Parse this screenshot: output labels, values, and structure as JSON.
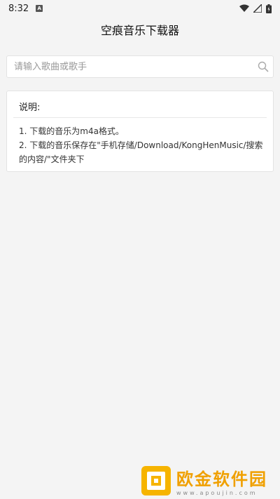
{
  "status_bar": {
    "time": "8:32",
    "notification_icon": "A",
    "icons": [
      "wifi-icon",
      "signal-icon",
      "battery-icon"
    ]
  },
  "app_bar": {
    "title": "空痕音乐下载器"
  },
  "search": {
    "placeholder": "请输入歌曲或歌手",
    "value": "",
    "icon": "search-icon"
  },
  "info": {
    "title": "说明:",
    "lines": [
      "1. 下载的音乐为m4a格式。",
      "2. 下载的音乐保存在\"手机存储/Download/KongHenMusic/搜索的内容/\"文件夹下"
    ]
  },
  "watermark": {
    "text": "欧金软件园",
    "url": "www.apoujin.com",
    "color": "#f0a000"
  }
}
